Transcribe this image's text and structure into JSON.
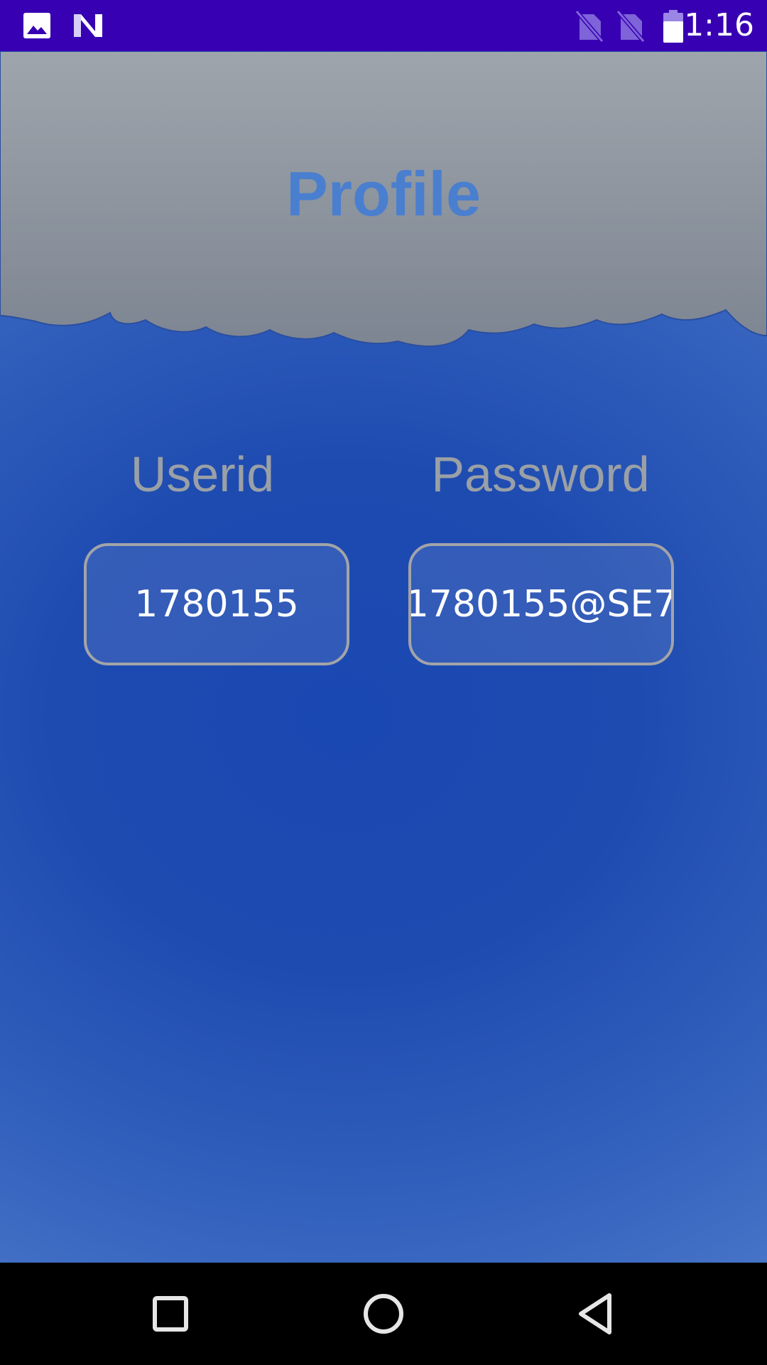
{
  "status_bar": {
    "time": "1:16",
    "icons": [
      "image-notification-icon",
      "n-notification-icon",
      "no-sim-icon",
      "no-sim-icon",
      "battery-icon"
    ],
    "background": "#3700b3"
  },
  "header": {
    "title": "Profile"
  },
  "fields": [
    {
      "label": "Userid",
      "value": "1780155"
    },
    {
      "label": "Password",
      "value": "1780155@SE7"
    }
  ],
  "nav_bar": {
    "buttons": [
      "recents-square-icon",
      "home-circle-icon",
      "back-triangle-icon"
    ]
  },
  "colors": {
    "title": "#4a7fcf",
    "label": "#9aa0a6",
    "field_border": "#a3a4a8",
    "background_blue": "#1e4bb0",
    "cloud": "#8e969f"
  }
}
